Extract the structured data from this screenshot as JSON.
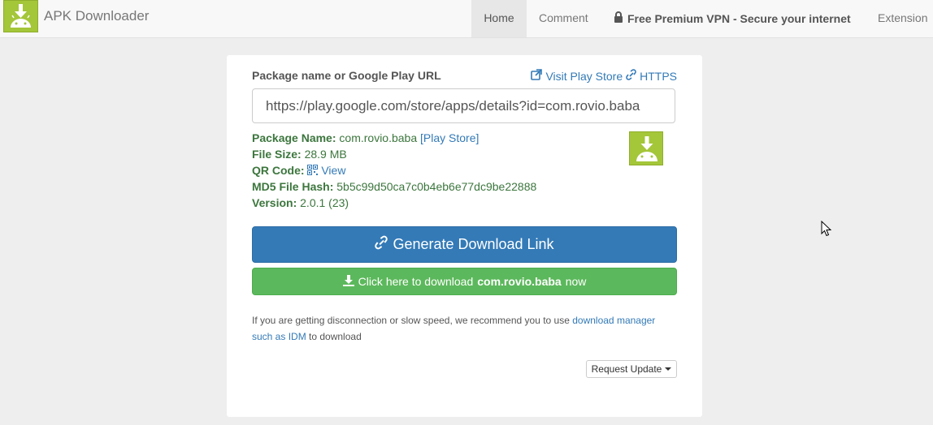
{
  "navbar": {
    "brand": "APK Downloader",
    "items": {
      "home": "Home",
      "comment": "Comment",
      "vpn": "Free Premium VPN - Secure your internet",
      "extension": "Extension"
    }
  },
  "form": {
    "label": "Package name or Google Play URL",
    "visit_store": "Visit Play Store",
    "https": "HTTPS",
    "url_value": "https://play.google.com/store/apps/details?id=com.rovio.baba"
  },
  "info": {
    "package_label": "Package Name:",
    "package_value": "com.rovio.baba",
    "play_store_link": "[Play Store]",
    "size_label": "File Size:",
    "size_value": "28.9 MB",
    "qr_label": "QR Code:",
    "qr_value": "View",
    "md5_label": "MD5 File Hash:",
    "md5_value": "5b5c99d50ca7c0b4eb6e77dc9be22888",
    "version_label": "Version:",
    "version_value": "2.0.1 (23)"
  },
  "buttons": {
    "generate": "Generate Download Link",
    "download_prefix": "Click here to download",
    "download_pkg": "com.rovio.baba",
    "download_suffix": "now",
    "request_update": "Request Update"
  },
  "note": {
    "text_before": "If you are getting disconnection or slow speed, we recommend you to use",
    "link": "download manager such as IDM",
    "text_after": "to download"
  },
  "icons": [
    "android-download-logo",
    "lock-icon",
    "external-link-icon",
    "link-icon",
    "qrcode-icon",
    "download-icon",
    "mouse-cursor-icon"
  ],
  "colors": {
    "primary": "#337ab7",
    "success": "#5cb85c",
    "info_text": "#3c763d",
    "android": "#a4c639"
  }
}
